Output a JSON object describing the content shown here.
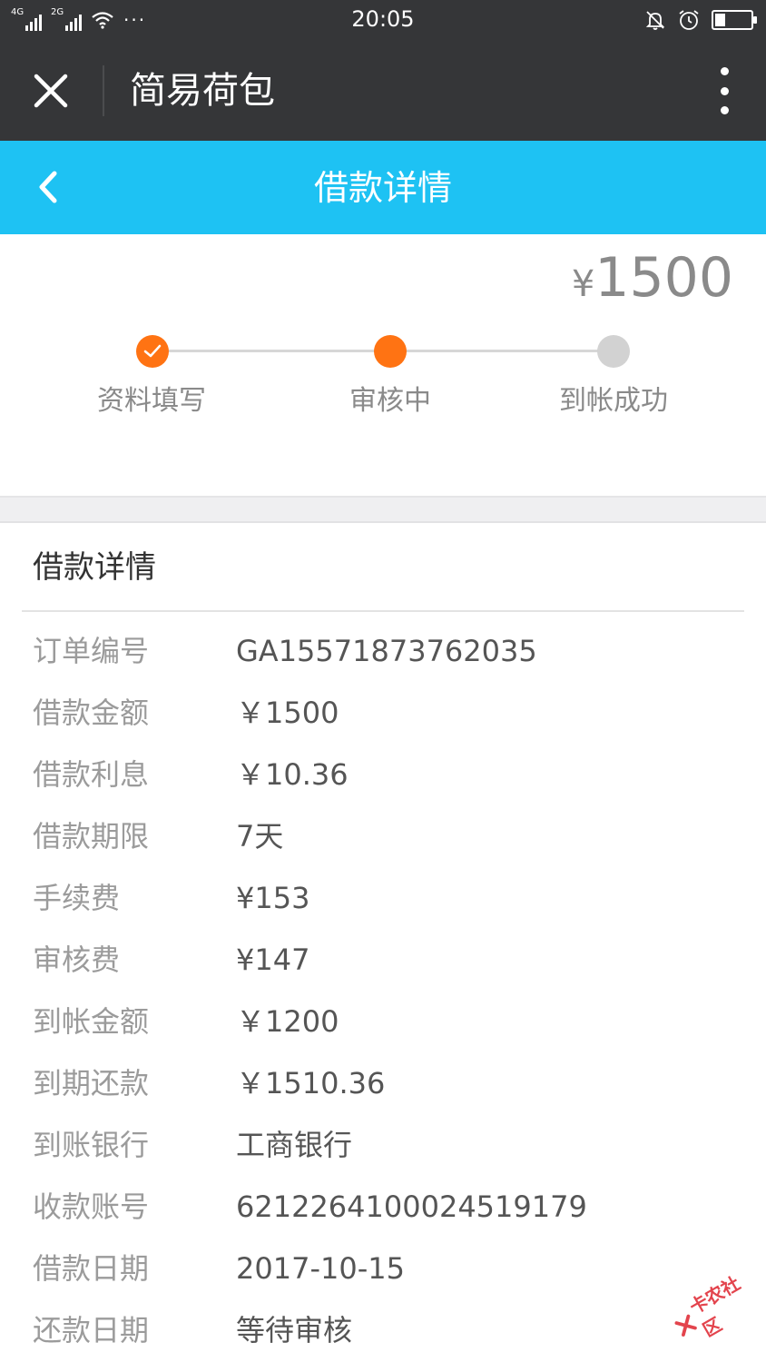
{
  "status_bar": {
    "network_1": "4G",
    "network_2": "2G",
    "more": "···",
    "time": "20:05",
    "battery_level": 0.3
  },
  "app_header": {
    "title": "简易荷包"
  },
  "title_bar": {
    "title": "借款详情"
  },
  "summary": {
    "currency": "¥",
    "amount": "1500"
  },
  "steps": [
    {
      "label": "资料填写",
      "state": "done"
    },
    {
      "label": "审核中",
      "state": "current"
    },
    {
      "label": "到帐成功",
      "state": "pending"
    }
  ],
  "colors": {
    "header_bg": "#353638",
    "title_bar_bg": "#1ec2f3",
    "step_active": "#ff7313",
    "step_pending": "#d2d2d2"
  },
  "details": {
    "title": "借款详情",
    "rows": [
      {
        "label": "订单编号",
        "value": "GA15571873762035"
      },
      {
        "label": "借款金额",
        "value": " ￥1500"
      },
      {
        "label": "借款利息",
        "value": " ￥10.36"
      },
      {
        "label": "借款期限",
        "value": "7天"
      },
      {
        "label": "手续费",
        "value": "¥153"
      },
      {
        "label": "审核费",
        "value": "¥147"
      },
      {
        "label": "到帐金额",
        "value": "￥1200"
      },
      {
        "label": "到期还款",
        "value": "￥1510.36"
      },
      {
        "label": "到账银行",
        "value": "工商银行"
      },
      {
        "label": "收款账号",
        "value": "6212264100024519179"
      },
      {
        "label": "借款日期",
        "value": "2017-10-15"
      },
      {
        "label": "还款日期",
        "value": "等待审核"
      }
    ]
  },
  "watermark": {
    "text": "卡农社区"
  }
}
